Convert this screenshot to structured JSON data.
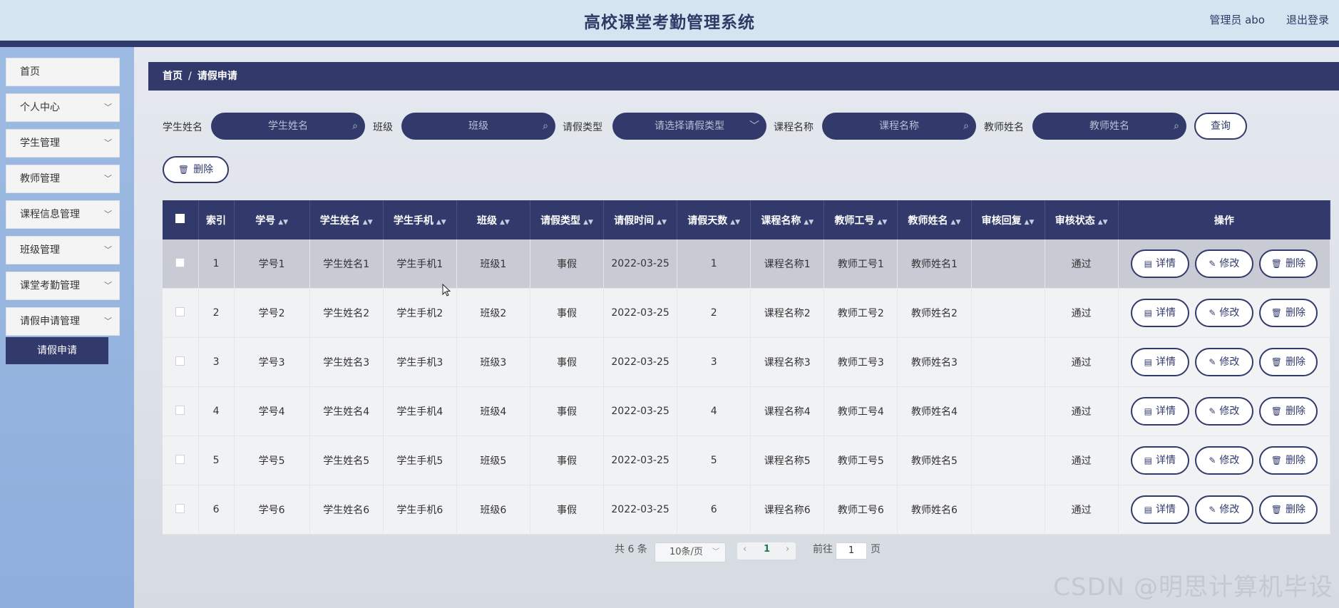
{
  "header": {
    "title": "高校课堂考勤管理系统",
    "user": "管理员 abo",
    "logout": "退出登录"
  },
  "sidebar": {
    "items": [
      {
        "label": "首页",
        "has_chevron": false
      },
      {
        "label": "个人中心",
        "has_chevron": true
      },
      {
        "label": "学生管理",
        "has_chevron": true
      },
      {
        "label": "教师管理",
        "has_chevron": true
      },
      {
        "label": "课程信息管理",
        "has_chevron": true
      },
      {
        "label": "班级管理",
        "has_chevron": true
      },
      {
        "label": "课堂考勤管理",
        "has_chevron": true
      },
      {
        "label": "请假申请管理",
        "has_chevron": true
      }
    ],
    "submenu_active": "请假申请"
  },
  "breadcrumb": {
    "home": "首页",
    "separator": "/",
    "current": "请假申请"
  },
  "search": {
    "student_name_label": "学生姓名",
    "student_name_placeholder": "学生姓名",
    "class_label": "班级",
    "class_placeholder": "班级",
    "leave_type_label": "请假类型",
    "leave_type_placeholder": "请选择请假类型",
    "course_label": "课程名称",
    "course_placeholder": "课程名称",
    "teacher_label": "教师姓名",
    "teacher_placeholder": "教师姓名",
    "query_button": "查询",
    "delete_button": "删除"
  },
  "table": {
    "columns": [
      "索引",
      "学号",
      "学生姓名",
      "学生手机",
      "班级",
      "请假类型",
      "请假时间",
      "请假天数",
      "课程名称",
      "教师工号",
      "教师姓名",
      "审核回复",
      "审核状态",
      "操作"
    ],
    "rows": [
      {
        "index": "1",
        "sid": "学号1",
        "name": "学生姓名1",
        "phone": "学生手机1",
        "cls": "班级1",
        "type": "事假",
        "date": "2022-03-25",
        "days": "1",
        "course": "课程名称1",
        "tid": "教师工号1",
        "tname": "教师姓名1",
        "reply": "",
        "status": "通过"
      },
      {
        "index": "2",
        "sid": "学号2",
        "name": "学生姓名2",
        "phone": "学生手机2",
        "cls": "班级2",
        "type": "事假",
        "date": "2022-03-25",
        "days": "2",
        "course": "课程名称2",
        "tid": "教师工号2",
        "tname": "教师姓名2",
        "reply": "",
        "status": "通过"
      },
      {
        "index": "3",
        "sid": "学号3",
        "name": "学生姓名3",
        "phone": "学生手机3",
        "cls": "班级3",
        "type": "事假",
        "date": "2022-03-25",
        "days": "3",
        "course": "课程名称3",
        "tid": "教师工号3",
        "tname": "教师姓名3",
        "reply": "",
        "status": "通过"
      },
      {
        "index": "4",
        "sid": "学号4",
        "name": "学生姓名4",
        "phone": "学生手机4",
        "cls": "班级4",
        "type": "事假",
        "date": "2022-03-25",
        "days": "4",
        "course": "课程名称4",
        "tid": "教师工号4",
        "tname": "教师姓名4",
        "reply": "",
        "status": "通过"
      },
      {
        "index": "5",
        "sid": "学号5",
        "name": "学生姓名5",
        "phone": "学生手机5",
        "cls": "班级5",
        "type": "事假",
        "date": "2022-03-25",
        "days": "5",
        "course": "课程名称5",
        "tid": "教师工号5",
        "tname": "教师姓名5",
        "reply": "",
        "status": "通过"
      },
      {
        "index": "6",
        "sid": "学号6",
        "name": "学生姓名6",
        "phone": "学生手机6",
        "cls": "班级6",
        "type": "事假",
        "date": "2022-03-25",
        "days": "6",
        "course": "课程名称6",
        "tid": "教师工号6",
        "tname": "教师姓名6",
        "reply": "",
        "status": "通过"
      }
    ],
    "actions": {
      "detail": "详情",
      "edit": "修改",
      "delete": "删除"
    }
  },
  "pagination": {
    "total": "共 6 条",
    "page_size": "10条/页",
    "current_page": "1",
    "goto_label": "前往",
    "goto_value": "1",
    "page_suffix": "页"
  },
  "watermark": "CSDN @明思计算机毕设",
  "colors": {
    "primary": "#323a6b",
    "header_bg": "#d4e4f1",
    "sidebar_bg": "#9dbbe2"
  }
}
